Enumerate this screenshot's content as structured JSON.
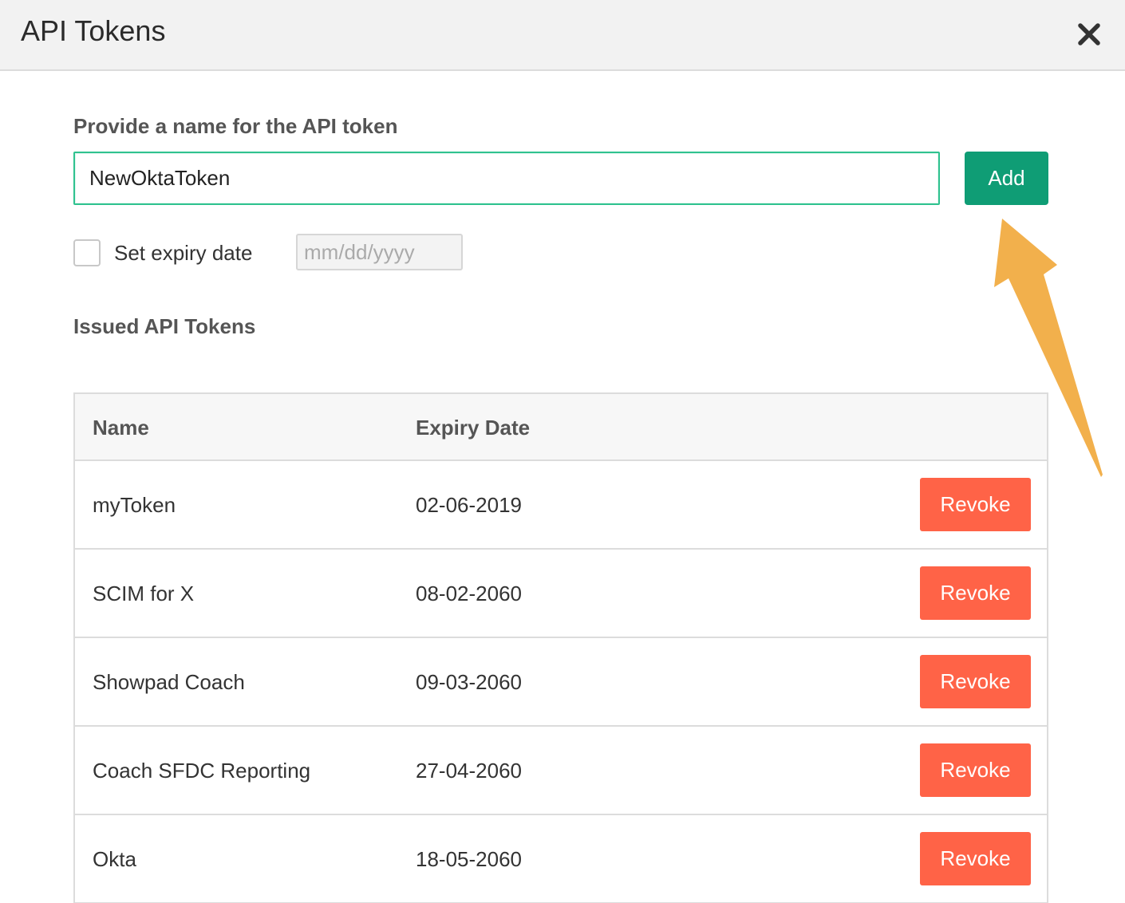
{
  "header": {
    "title": "API Tokens",
    "close_icon": "close-icon"
  },
  "form": {
    "name_label": "Provide a name for the API token",
    "name_value": "NewOktaToken",
    "add_label": "Add",
    "accent_color": "#0f9d75",
    "expiry_checked": false,
    "expiry_label": "Set expiry date",
    "date_placeholder": "mm/dd/yyyy"
  },
  "tokens": {
    "section_title": "Issued API Tokens",
    "columns": [
      "Name",
      "Expiry Date"
    ],
    "revoke_color": "#ff6347",
    "rows": [
      {
        "name": "myToken",
        "expiry": "02-06-2019",
        "action": "Revoke"
      },
      {
        "name": "SCIM for X",
        "expiry": "08-02-2060",
        "action": "Revoke"
      },
      {
        "name": "Showpad Coach",
        "expiry": "09-03-2060",
        "action": "Revoke"
      },
      {
        "name": "Coach SFDC Reporting",
        "expiry": "27-04-2060",
        "action": "Revoke"
      },
      {
        "name": "Okta",
        "expiry": "18-05-2060",
        "action": "Revoke"
      }
    ]
  },
  "annotation": {
    "arrow_icon": "arrow-annotation-icon",
    "arrow_color": "#f2b04c"
  }
}
